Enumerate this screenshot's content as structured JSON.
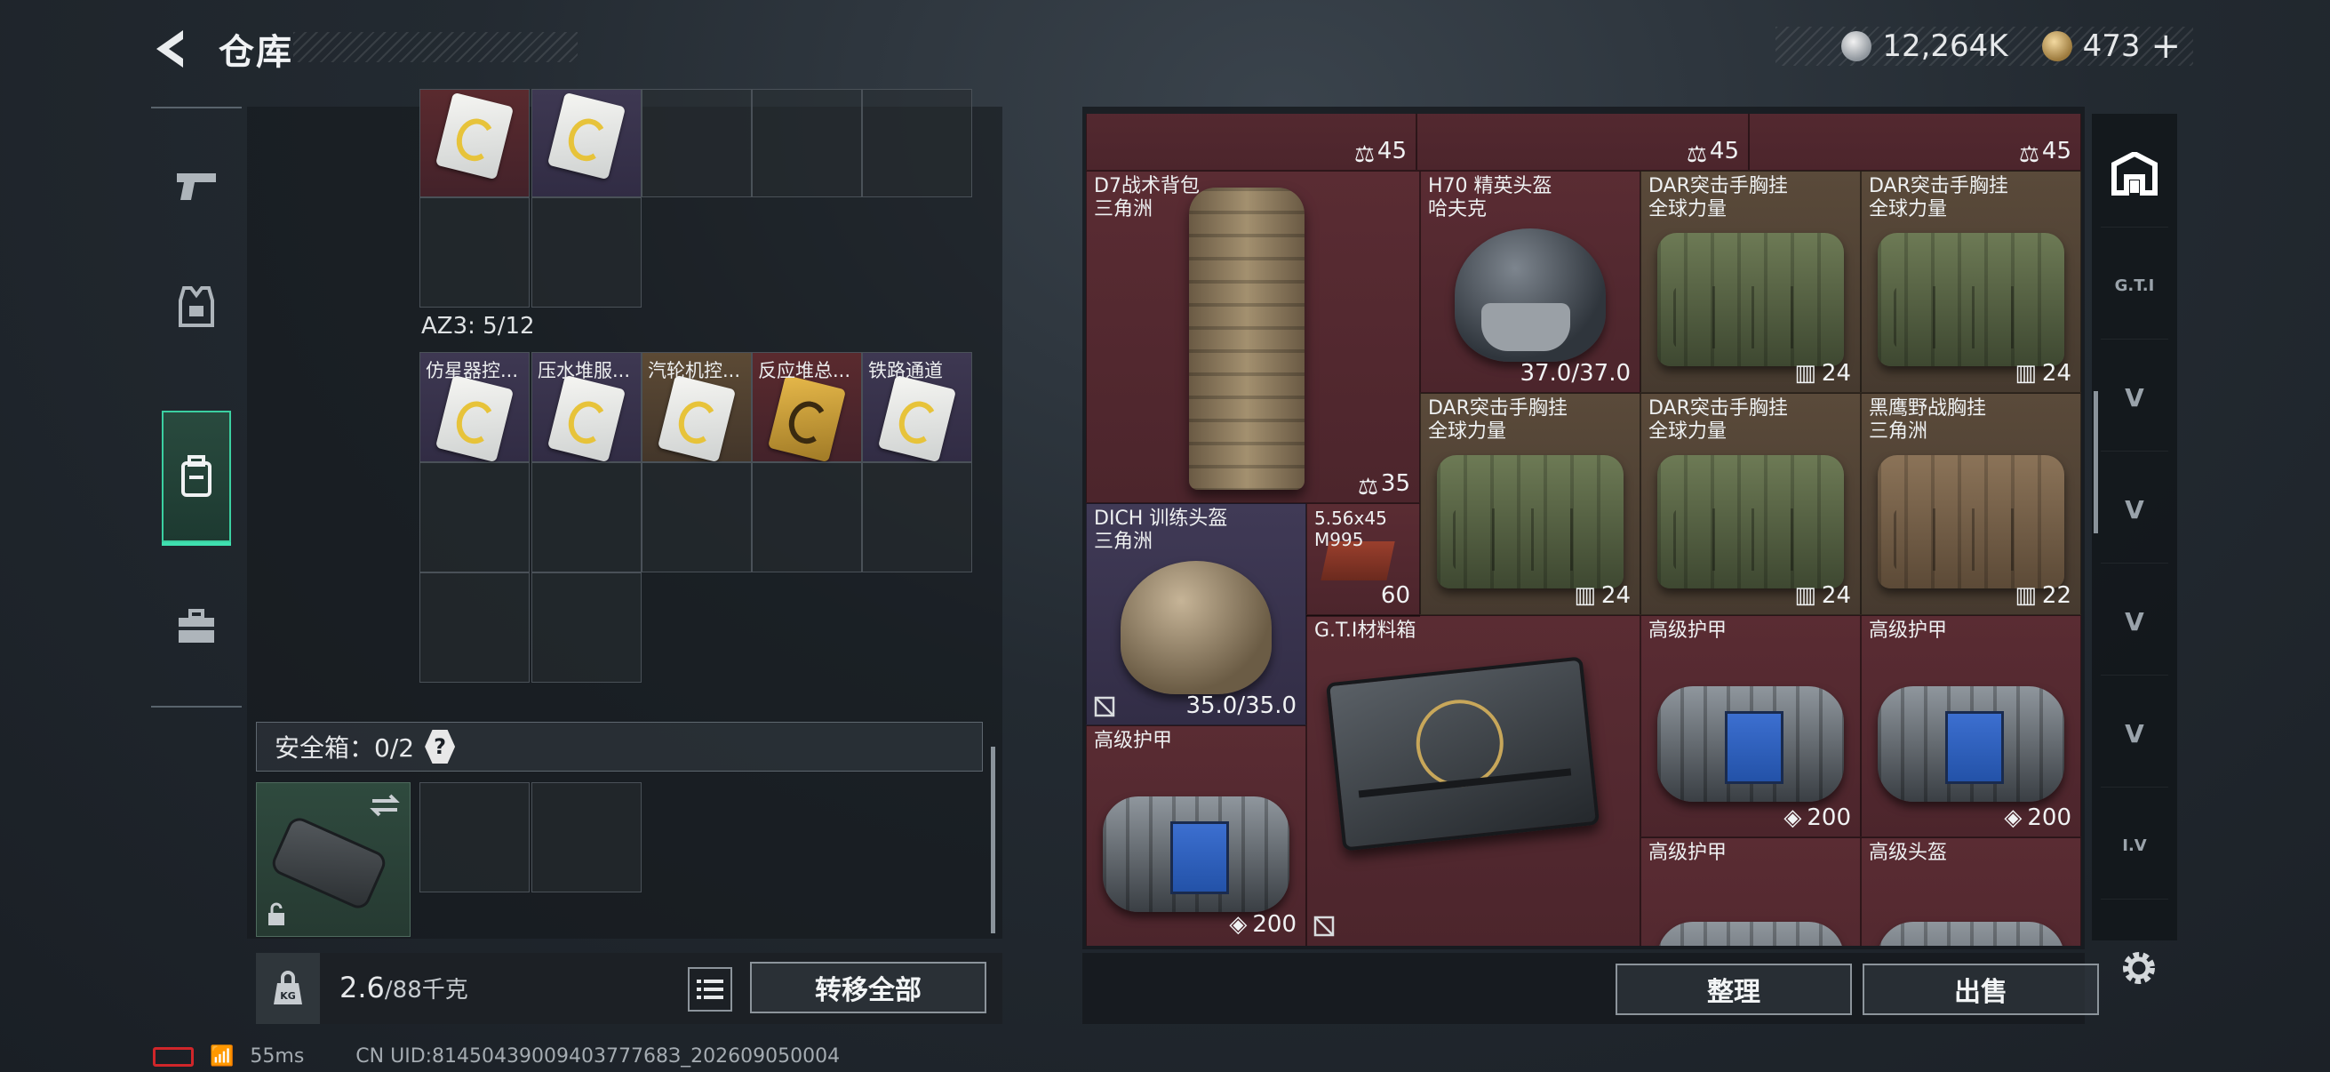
{
  "header": {
    "title": "仓库"
  },
  "currency": {
    "silver": "12,264K",
    "gold": "473",
    "gold_add": "+"
  },
  "left_panel": {
    "top_items": [
      {
        "bg": "item-red"
      },
      {
        "bg": "item-purple"
      }
    ],
    "az3_label": "AZ3: 5/12",
    "az3_items": [
      {
        "name": "仿星器控...",
        "bg": "item-purple",
        "card": "white"
      },
      {
        "name": "压水堆服...",
        "bg": "item-purple",
        "card": "white"
      },
      {
        "name": "汽轮机控...",
        "bg": "item-brown",
        "card": "white"
      },
      {
        "name": "反应堆总...",
        "bg": "item-red",
        "card": "gold"
      },
      {
        "name": "铁路通道",
        "bg": "item-purple",
        "card": "white"
      }
    ],
    "safe_label": "安全箱：0/2",
    "safe_help": "?",
    "weight": "2.6",
    "weight_max": "/88千克",
    "kg_label": "KG",
    "transfer_all": "转移全部"
  },
  "stash": {
    "top_counts": [
      "45",
      "45",
      "45"
    ],
    "items": [
      {
        "id": "d7",
        "name": "D7战术背包\n三角洲",
        "value": "35",
        "icon": "backpack"
      },
      {
        "id": "h70",
        "name": "H70 精英头盔\n哈夫克",
        "value": "37.0/37.0",
        "icon": ""
      },
      {
        "id": "dar1",
        "name": "DAR突击手胸挂\n全球力量",
        "value": "24",
        "icon": "vest"
      },
      {
        "id": "dar2",
        "name": "DAR突击手胸挂\n全球力量",
        "value": "24",
        "icon": "vest"
      },
      {
        "id": "dar3",
        "name": "DAR突击手胸挂\n全球力量",
        "value": "24",
        "icon": "vest"
      },
      {
        "id": "dar4",
        "name": "DAR突击手胸挂\n全球力量",
        "value": "24",
        "icon": "vest"
      },
      {
        "id": "eagle",
        "name": "黑鹰野战胸挂\n三角洲",
        "value": "22",
        "icon": "vest"
      },
      {
        "id": "dich",
        "name": "DICH 训练头盔\n三角洲",
        "value": "35.0/35.0",
        "icon": ""
      },
      {
        "id": "ammo",
        "name": "5.56x45\nM995",
        "value": "60",
        "icon": ""
      },
      {
        "id": "gti",
        "name": "G.T.I材料箱",
        "value": "",
        "icon": ""
      },
      {
        "id": "armor1",
        "name": "高级护甲",
        "value": "200",
        "icon": "shield"
      },
      {
        "id": "armor2",
        "name": "高级护甲",
        "value": "200",
        "icon": "shield"
      },
      {
        "id": "armor3",
        "name": "高级护甲",
        "value": "200",
        "icon": "shield"
      },
      {
        "id": "armor4",
        "name": "高级护甲",
        "value": "",
        "icon": ""
      },
      {
        "id": "helm2",
        "name": "高级头盔",
        "value": "",
        "icon": ""
      }
    ],
    "sort_label": "整理",
    "sell_label": "出售"
  },
  "right_nav": [
    {
      "label": "",
      "icon": "stash-icon"
    },
    {
      "label": "G.T.I",
      "icon": "gti-tab-icon"
    },
    {
      "label": "V",
      "icon": "v-tab-icon"
    },
    {
      "label": "V",
      "icon": "v-tab-icon"
    },
    {
      "label": "V",
      "icon": "v-tab-icon"
    },
    {
      "label": "V",
      "icon": "v-tab-icon"
    },
    {
      "label": "I.V",
      "icon": "iv-tab-icon"
    }
  ],
  "status_bar": {
    "ping": "55ms",
    "uid": "CN UID:8145043900940377768З_202609050004"
  }
}
